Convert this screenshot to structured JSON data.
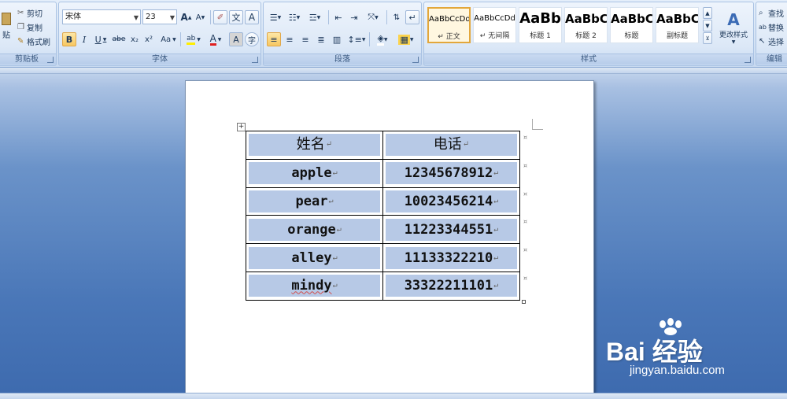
{
  "ribbon": {
    "clipboard": {
      "paste_label": "贴",
      "cut_label": "剪切",
      "copy_label": "复制",
      "format_painter_label": "格式刷",
      "group_label": "剪贴板"
    },
    "font": {
      "font_name": "宋体",
      "font_size": "23",
      "grow_label": "A",
      "shrink_label": "A",
      "phonetic_label": "文",
      "border_label": "A",
      "bold_label": "B",
      "italic_label": "I",
      "underline_label": "U",
      "strike_label": "abe",
      "subscript_label": "x₂",
      "superscript_label": "x²",
      "case_label": "Aa",
      "highlight_label": "ab",
      "font_color_label": "A",
      "shade_label": "A",
      "enclose_label": "字",
      "group_label": "字体"
    },
    "paragraph": {
      "group_label": "段落"
    },
    "styles": {
      "tiles": [
        {
          "sample": "AaBbCcDd",
          "name": "↵ 正文"
        },
        {
          "sample": "AaBbCcDd",
          "name": "↵ 无间隔"
        },
        {
          "sample": "AaBb",
          "name": "标题 1"
        },
        {
          "sample": "AaBbC",
          "name": "标题 2"
        },
        {
          "sample": "AaBbC",
          "name": "标题"
        },
        {
          "sample": "AaBbC",
          "name": "副标题"
        }
      ],
      "change_styles_label": "更改样式",
      "group_label": "样式"
    },
    "editing": {
      "find_label": "查找",
      "replace_label": "替换",
      "select_label": "选择",
      "group_label": "编辑"
    }
  },
  "document": {
    "table": {
      "headers": [
        "姓名",
        "电话"
      ],
      "rows": [
        [
          "apple",
          "12345678912"
        ],
        [
          "pear",
          "10023456214"
        ],
        [
          "orange",
          "11223344551"
        ],
        [
          "alley",
          "11133322210"
        ],
        [
          "mindy",
          "33322211101"
        ]
      ],
      "cell_mark": "↵"
    }
  },
  "watermark": {
    "brand": "Bai  经验",
    "site": "jingyan.baidu.com"
  },
  "colors": {
    "cell_shading": "#b7c9e6",
    "ribbon_bg": "#dce8f7",
    "workspace_blue": "#4a77b8"
  }
}
